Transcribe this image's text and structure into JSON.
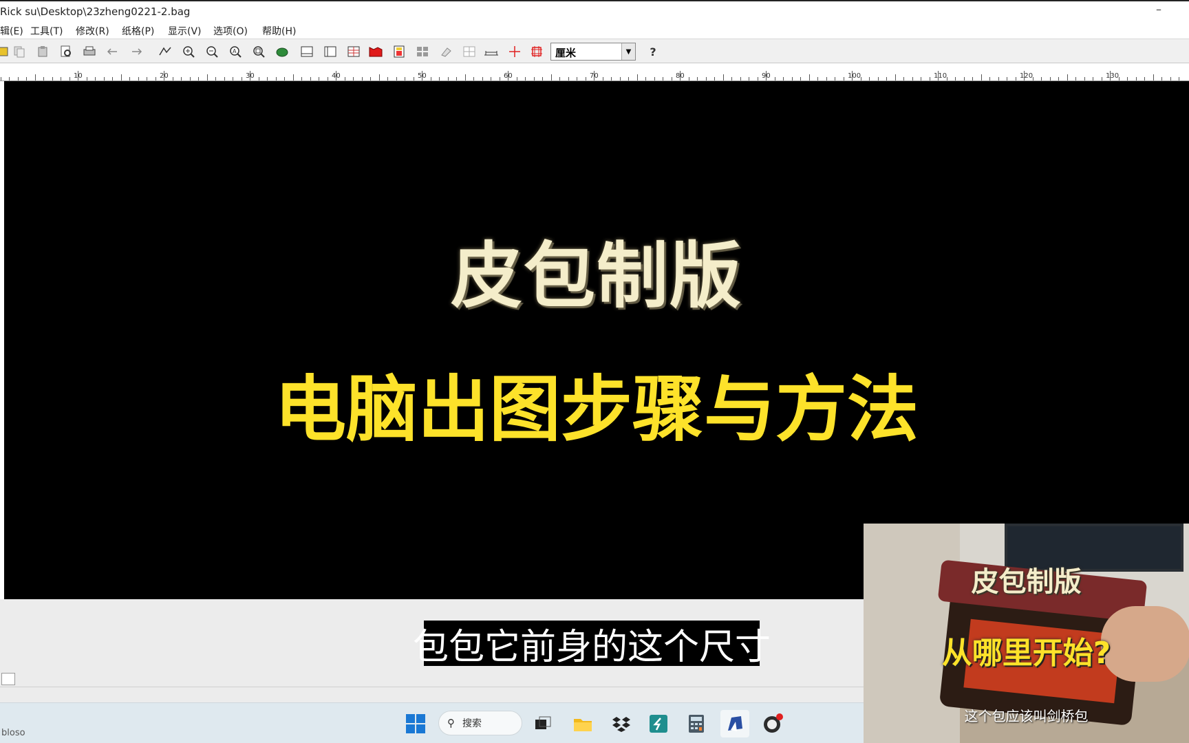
{
  "window": {
    "title": "Rick su\\Desktop\\23zheng0221-2.bag",
    "minimize_glyph": "–"
  },
  "menu": [
    {
      "label": "辑(E)"
    },
    {
      "label": "工具(T)"
    },
    {
      "label": "修改(R)"
    },
    {
      "label": "纸格(P)"
    },
    {
      "label": "显示(V)"
    },
    {
      "label": "选项(O)"
    },
    {
      "label": "帮助(H)"
    }
  ],
  "toolbar": {
    "icons": [
      "open-icon",
      "copy-icon",
      "paste-icon",
      "preview-icon",
      "print-icon",
      "undo-icon",
      "redo-icon",
      "select-tool-icon",
      "zoom-in-icon",
      "zoom-out-icon",
      "zoom-window-icon",
      "zoom-all-icon",
      "pan-icon",
      "grid-icon",
      "frame-icon",
      "table-icon",
      "red-shape-icon",
      "layers-icon",
      "tiles-icon",
      "eraser-icon",
      "split-icon",
      "measure-icon",
      "crosshair-icon",
      "mark-icon"
    ],
    "unit_select_value": "厘米",
    "help_label": "?"
  },
  "ruler": {
    "labels": [
      "10",
      "20",
      "30",
      "40",
      "50",
      "60",
      "70",
      "80",
      "90",
      "100",
      "110",
      "120",
      "130"
    ]
  },
  "canvas": {
    "heading_line1": "皮包制版",
    "heading_line2": "电脑出图步骤与方法",
    "heading_line1_color": "#f4edca",
    "heading_line2_color": "#fde22a"
  },
  "subtitle": "包包它前身的这个尺寸",
  "taskbar": {
    "left_text": "bloso",
    "search_label": "搜索",
    "apps": [
      "windows-start-icon",
      "search-icon",
      "task-view-icon",
      "file-explorer-icon",
      "dropbox-icon",
      "app-s-icon",
      "calculator-icon",
      "paint-app-icon",
      "obs-icon"
    ]
  },
  "pip": {
    "title": "皮包制版",
    "question": "从哪里开始?",
    "caption": "这个包应该叫剑桥包"
  }
}
